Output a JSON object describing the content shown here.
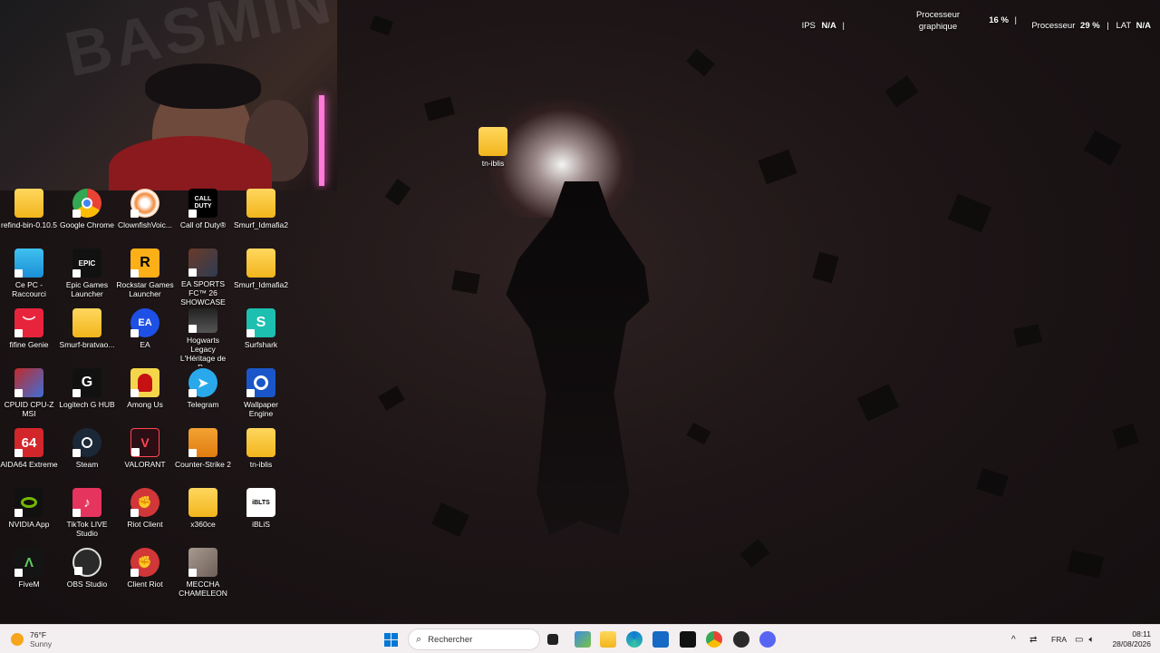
{
  "overlay": {
    "ips_label": "IPS",
    "ips_value": "N/A",
    "gpu_label_line1": "Processeur",
    "gpu_label_line2": "graphique",
    "gpu_value": "16 %",
    "cpu_label": "Processeur",
    "cpu_value": "29 %",
    "lat_label": "LAT",
    "lat_value": "N/A"
  },
  "desktop": {
    "floating_icon": {
      "label": "tn-iblis",
      "icon": "folder-icon"
    },
    "icons": [
      {
        "label": "refind-bin-0.10.5",
        "icon": "folder-icon"
      },
      {
        "label": "Google Chrome",
        "icon": "chrome-icon"
      },
      {
        "label": "ClownfishVoic...",
        "icon": "clownfish-icon"
      },
      {
        "label": "Call of Duty®",
        "icon": "call-of-duty-icon"
      },
      {
        "label": "Smurf_Idmafia2",
        "icon": "folder-icon"
      },
      {
        "label": "Ce PC - Raccourci",
        "icon": "computer-icon"
      },
      {
        "label": "Epic Games Launcher",
        "icon": "epic-games-icon"
      },
      {
        "label": "Rockstar Games Launcher",
        "icon": "rockstar-icon"
      },
      {
        "label": "EA SPORTS FC™ 26 SHOWCASE",
        "icon": "ea-fc-icon"
      },
      {
        "label": "Smurf_Idmafia2",
        "icon": "folder-icon"
      },
      {
        "label": "fifine Genie",
        "icon": "fifine-icon"
      },
      {
        "label": "Smurf-bratvao...",
        "icon": "folder-icon"
      },
      {
        "label": "EA",
        "icon": "ea-icon"
      },
      {
        "label": "Hogwarts Legacy L'Héritage de P...",
        "icon": "hogwarts-icon"
      },
      {
        "label": "Surfshark",
        "icon": "surfshark-icon"
      },
      {
        "label": "CPUID CPU-Z MSI",
        "icon": "cpuz-icon"
      },
      {
        "label": "Logitech G HUB",
        "icon": "logitech-icon"
      },
      {
        "label": "Among Us",
        "icon": "among-us-icon"
      },
      {
        "label": "Telegram",
        "icon": "telegram-icon"
      },
      {
        "label": "Wallpaper Engine",
        "icon": "wallpaper-engine-icon"
      },
      {
        "label": "AIDA64 Extreme",
        "icon": "aida64-icon"
      },
      {
        "label": "Steam",
        "icon": "steam-icon"
      },
      {
        "label": "VALORANT",
        "icon": "valorant-icon"
      },
      {
        "label": "Counter-Strike 2",
        "icon": "counter-strike-icon"
      },
      {
        "label": "tn-iblis",
        "icon": "folder-icon"
      },
      {
        "label": "NVIDIA App",
        "icon": "nvidia-icon"
      },
      {
        "label": "TikTok LIVE Studio",
        "icon": "tiktok-icon"
      },
      {
        "label": "Riot Client",
        "icon": "riot-icon"
      },
      {
        "label": "x360ce",
        "icon": "folder-icon"
      },
      {
        "label": "iBLiS",
        "icon": "iblis-icon"
      },
      {
        "label": "FiveM",
        "icon": "fivem-icon"
      },
      {
        "label": "OBS Studio",
        "icon": "obs-icon"
      },
      {
        "label": "Client Riot",
        "icon": "riot-icon"
      },
      {
        "label": "MECCHA CHAMELEON",
        "icon": "meccha-icon"
      }
    ]
  },
  "taskbar": {
    "weather_temp": "76°F",
    "weather_desc": "Sunny",
    "search_placeholder": "Rechercher",
    "language": "FRA",
    "time": "08:11",
    "date": "28/08/2026",
    "colors": {
      "accent": "#0078d4",
      "background": "#f3eef0"
    }
  }
}
